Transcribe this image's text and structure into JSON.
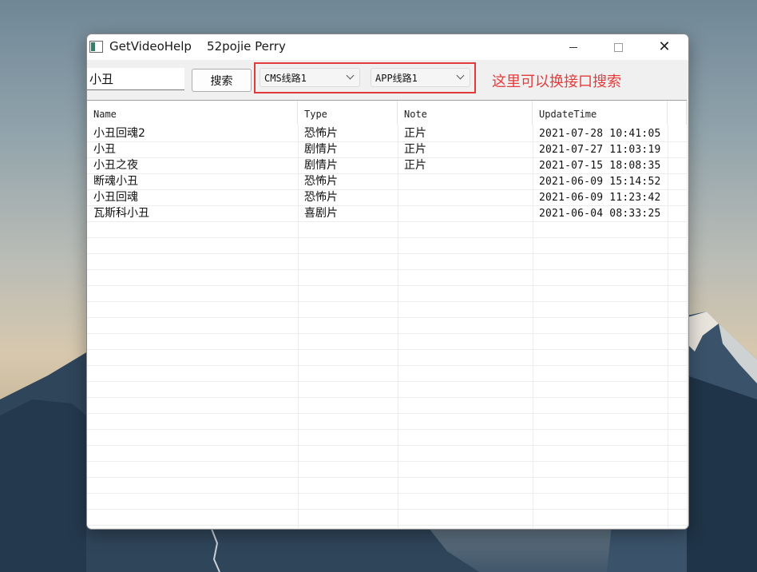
{
  "window": {
    "title": "GetVideoHelp    52pojie Perry",
    "minimize": "—",
    "maximize": "□",
    "close": "✕"
  },
  "toolbar": {
    "search_value": "小丑",
    "search_button": "搜索",
    "cms_line": "CMS线路1",
    "app_line": "APP线路1",
    "annotation": "这里可以换接口搜索"
  },
  "table": {
    "headers": [
      "Name",
      "Type",
      "Note",
      "UpdateTime"
    ],
    "rows": [
      {
        "name": "小丑回魂2",
        "type": "恐怖片",
        "note": "正片",
        "time": "2021-07-28 10:41:05"
      },
      {
        "name": "小丑",
        "type": "剧情片",
        "note": "正片",
        "time": "2021-07-27 11:03:19"
      },
      {
        "name": "小丑之夜",
        "type": "剧情片",
        "note": "正片",
        "time": "2021-07-15 18:08:35"
      },
      {
        "name": "断魂小丑",
        "type": "恐怖片",
        "note": "",
        "time": "2021-06-09 15:14:52"
      },
      {
        "name": "小丑回魂",
        "type": "恐怖片",
        "note": "",
        "time": "2021-06-09 11:23:42"
      },
      {
        "name": "瓦斯科小丑",
        "type": "喜剧片",
        "note": "",
        "time": "2021-06-04 08:33:25"
      }
    ]
  },
  "colors": {
    "annotation": "#e53b3b",
    "frame": "#e03a3a"
  }
}
